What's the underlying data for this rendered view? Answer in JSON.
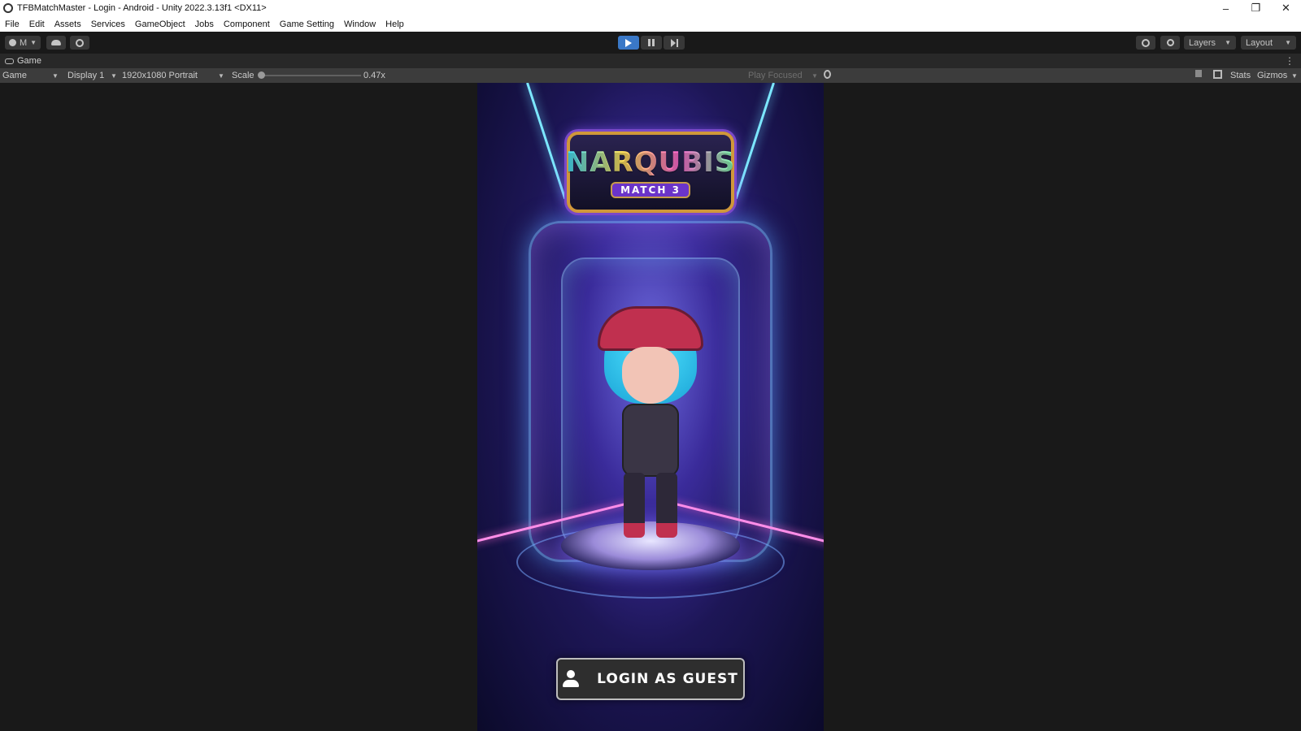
{
  "window": {
    "title": "TFBMatchMaster - Login - Android - Unity 2022.3.13f1 <DX11>",
    "controls": {
      "minimize": "–",
      "restore": "❐",
      "close": "✕"
    }
  },
  "menu": [
    "File",
    "Edit",
    "Assets",
    "Services",
    "GameObject",
    "Jobs",
    "Component",
    "Game Setting",
    "Window",
    "Help"
  ],
  "toolbar": {
    "account_label": "M",
    "layers_label": "Layers",
    "layout_label": "Layout"
  },
  "tab": {
    "label": "Game"
  },
  "gamebar": {
    "view_select": "Game",
    "display_select": "Display 1",
    "resolution_select": "1920x1080 Portrait",
    "scale_label": "Scale",
    "scale_value": "0.47x",
    "play_focused": "Play Focused",
    "stats": "Stats",
    "gizmos": "Gizmos"
  },
  "game": {
    "logo_title": "NARQUBIS",
    "logo_subtitle": "MATCH 3",
    "login_button": "LOGIN AS GUEST"
  },
  "colors": {
    "play_accent": "#3a78c7",
    "editor_bg": "#191919",
    "panel_bg": "#3c3c3c"
  }
}
